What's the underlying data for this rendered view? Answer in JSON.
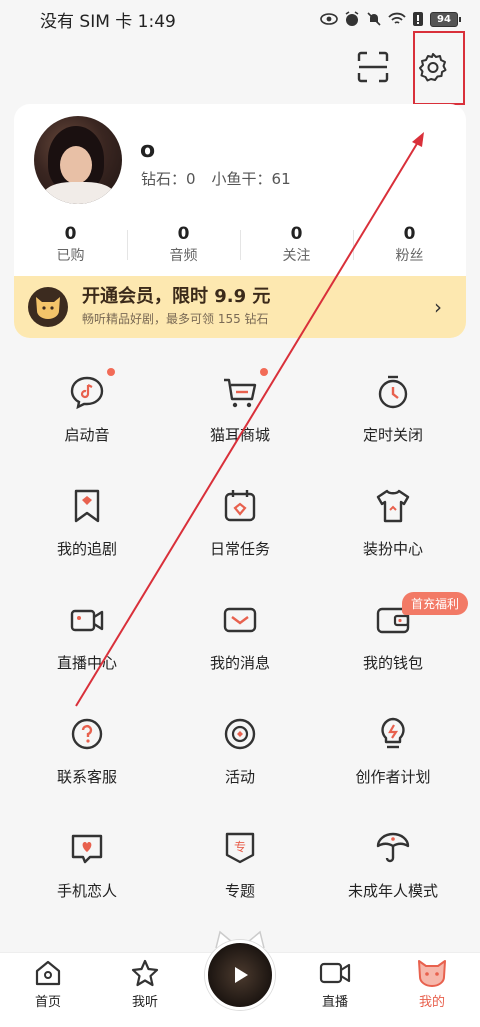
{
  "status_bar": {
    "carrier_time": "没有 SIM 卡 1:49",
    "battery": "94"
  },
  "header": {
    "scan_icon": "scan-icon",
    "settings_icon": "gear-icon"
  },
  "profile": {
    "username": "o",
    "diamonds": "钻石：0",
    "fish": "小鱼干：61",
    "stats": [
      {
        "num": "0",
        "label": "已购"
      },
      {
        "num": "0",
        "label": "音频"
      },
      {
        "num": "0",
        "label": "关注"
      },
      {
        "num": "0",
        "label": "粉丝"
      }
    ]
  },
  "vip": {
    "title": "开通会员，限时 9.9 元",
    "subtitle": "畅听精品好剧，最多可领 155 钻石",
    "arrow": "›"
  },
  "grid": [
    {
      "label": "启动音",
      "icon": "boot-sound-icon",
      "dot": true
    },
    {
      "label": "猫耳商城",
      "icon": "shopping-cart-icon",
      "dot": true
    },
    {
      "label": "定时关闭",
      "icon": "timer-icon",
      "dot": false
    },
    {
      "label": "我的追剧",
      "icon": "bookmark-icon",
      "dot": false
    },
    {
      "label": "日常任务",
      "icon": "calendar-icon",
      "dot": false
    },
    {
      "label": "装扮中心",
      "icon": "tshirt-icon",
      "dot": false
    },
    {
      "label": "直播中心",
      "icon": "video-camera-icon",
      "dot": false
    },
    {
      "label": "我的消息",
      "icon": "mail-icon",
      "dot": false
    },
    {
      "label": "我的钱包",
      "icon": "wallet-icon",
      "dot": false
    },
    {
      "label": "联系客服",
      "icon": "help-icon",
      "dot": false
    },
    {
      "label": "活动",
      "icon": "activity-icon",
      "dot": false
    },
    {
      "label": "创作者计划",
      "icon": "lightbulb-icon",
      "dot": false
    },
    {
      "label": "手机恋人",
      "icon": "heart-chat-icon",
      "dot": false
    },
    {
      "label": "专题",
      "icon": "topic-icon",
      "dot": false
    },
    {
      "label": "未成年人模式",
      "icon": "umbrella-icon",
      "dot": false
    }
  ],
  "wallet_promo": "首充福利",
  "topic_glyph": "专",
  "bottom_nav": [
    {
      "label": "首页",
      "icon": "home-icon",
      "active": false
    },
    {
      "label": "我听",
      "icon": "star-icon",
      "active": false
    },
    {
      "label": "直播",
      "icon": "live-camera-icon",
      "active": false
    },
    {
      "label": "我的",
      "icon": "cat-face-icon",
      "active": true
    }
  ],
  "colors": {
    "accent": "#e8614e",
    "vip_bg": "#fde8b0",
    "highlight": "#d9303a",
    "dot": "#f26b57"
  }
}
